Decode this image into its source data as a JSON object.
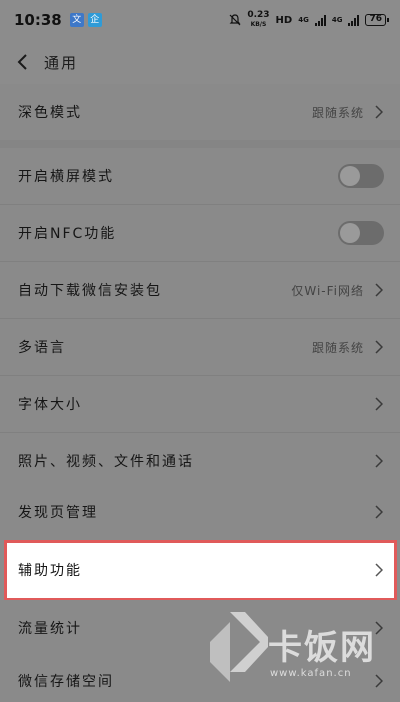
{
  "status_bar": {
    "time": "10:38",
    "app_icon_1": "文",
    "app_icon_2": "企",
    "net_speed": "0.23",
    "net_speed_unit": "KB/S",
    "hd_label": "HD",
    "net_4g_1": "4G",
    "net_4g_2": "4G",
    "battery": "76"
  },
  "header": {
    "title": "通用"
  },
  "settings": {
    "dark_mode": {
      "label": "深色模式",
      "value": "跟随系统"
    },
    "landscape": {
      "label": "开启横屏模式",
      "enabled": false
    },
    "nfc": {
      "label": "开启NFC功能",
      "enabled": false
    },
    "auto_download": {
      "label": "自动下载微信安装包",
      "value": "仅Wi-Fi网络"
    },
    "language": {
      "label": "多语言",
      "value": "跟随系统"
    },
    "font_size": {
      "label": "字体大小"
    },
    "media": {
      "label": "照片、视频、文件和通话"
    },
    "discover": {
      "label": "发现页管理"
    },
    "accessibility": {
      "label": "辅助功能"
    },
    "data_usage": {
      "label": "流量统计"
    },
    "storage": {
      "label": "微信存储空间"
    }
  },
  "watermark": {
    "brand": "卡饭网",
    "url": "www.kafan.cn"
  },
  "colors": {
    "highlight_border": "#e05a5a",
    "dim_background": "#8c8c8c"
  }
}
